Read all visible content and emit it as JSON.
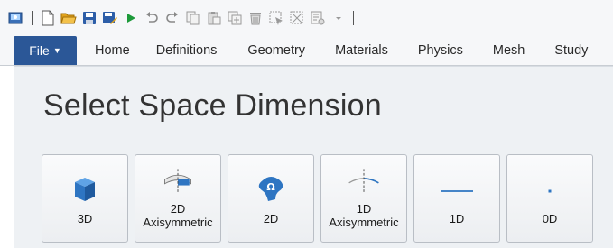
{
  "quick_access": {
    "icons": [
      "app-icon",
      "new-icon",
      "open-icon",
      "save-icon",
      "save-as-icon",
      "run-icon",
      "undo-icon",
      "redo-icon",
      "copy-icon",
      "paste-icon",
      "duplicate-icon",
      "delete-icon",
      "select-icon",
      "deselect-icon",
      "options-icon",
      "customize-dropdown-icon"
    ]
  },
  "ribbon": {
    "file_label": "File",
    "tabs": [
      {
        "label": "Home"
      },
      {
        "label": "Definitions"
      },
      {
        "label": "Geometry"
      },
      {
        "label": "Materials"
      },
      {
        "label": "Physics"
      },
      {
        "label": "Mesh"
      },
      {
        "label": "Study"
      }
    ]
  },
  "panel": {
    "title": "Select Space Dimension",
    "buttons": [
      {
        "label": "3D",
        "icon": "cube-icon"
      },
      {
        "line1": "2D",
        "line2": "Axisymmetric",
        "icon": "axisymmetric-2d-icon"
      },
      {
        "label": "2D",
        "icon": "omega-domain-icon"
      },
      {
        "line1": "1D",
        "line2": "Axisymmetric",
        "icon": "axisymmetric-1d-icon"
      },
      {
        "label": "1D",
        "icon": "line-icon"
      },
      {
        "label": "0D",
        "icon": "point-icon"
      }
    ]
  },
  "colors": {
    "file_tab": "#2b5797",
    "accent_blue": "#2e75c2",
    "panel_bg": "#eef1f4"
  }
}
